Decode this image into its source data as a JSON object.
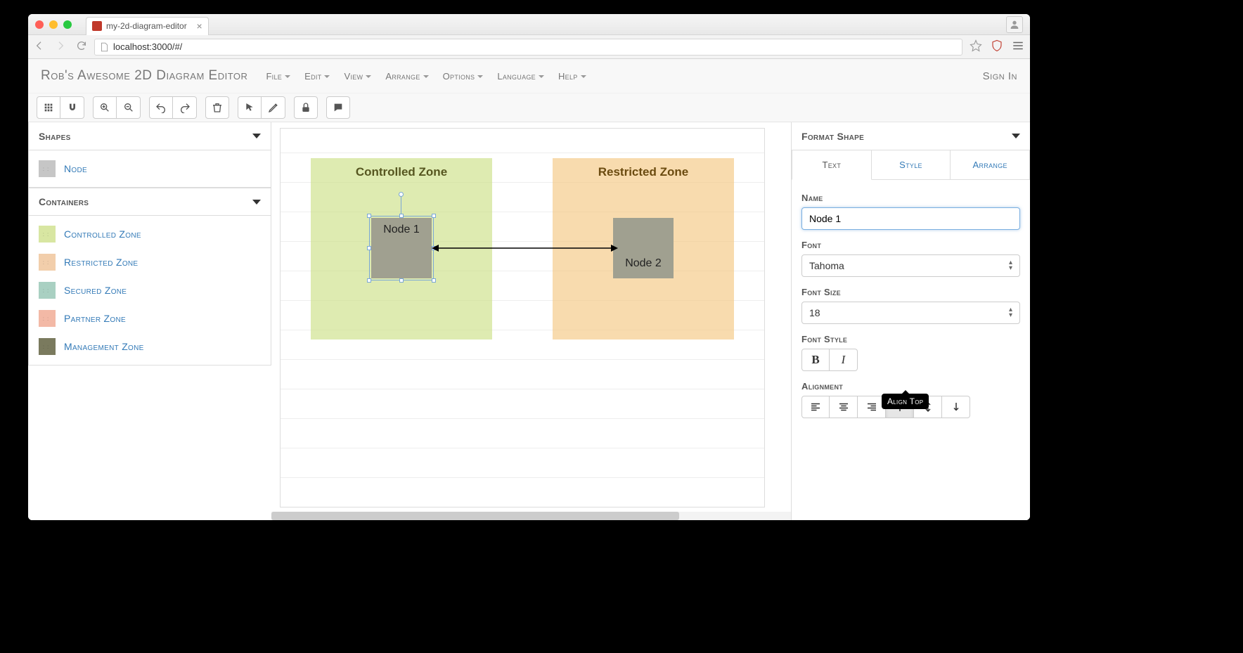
{
  "browser": {
    "tab_title": "my-2d-diagram-editor",
    "url": "localhost:3000/#/"
  },
  "app": {
    "title": "Rob's Awesome 2D Diagram Editor",
    "signin": "Sign In"
  },
  "menus": [
    "File",
    "Edit",
    "View",
    "Arrange",
    "Options",
    "Language",
    "Help"
  ],
  "left": {
    "shapes_label": "Shapes",
    "containers_label": "Containers",
    "shapes": [
      {
        "label": "Node",
        "color": "#c6c6c6"
      }
    ],
    "containers": [
      {
        "label": "Controlled Zone",
        "color": "#d8e6a2"
      },
      {
        "label": "Restricted Zone",
        "color": "#f2ceab"
      },
      {
        "label": "Secured Zone",
        "color": "#a9d0c2"
      },
      {
        "label": "Partner Zone",
        "color": "#f3b9a6"
      },
      {
        "label": "Management Zone",
        "color": "#7a7a5e"
      }
    ]
  },
  "canvas": {
    "zone1_title": "Controlled Zone",
    "zone2_title": "Restricted Zone",
    "node1_label": "Node 1",
    "node2_label": "Node 2"
  },
  "right": {
    "header": "Format Shape",
    "tabs": {
      "text": "Text",
      "style": "Style",
      "arrange": "Arrange"
    },
    "name_label": "Name",
    "name_value": "Node 1",
    "font_label": "Font",
    "font_value": "Tahoma",
    "fontsize_label": "Font Size",
    "fontsize_value": "18",
    "fontstyle_label": "Font Style",
    "alignment_label": "Alignment",
    "tooltip": "Align Top"
  }
}
